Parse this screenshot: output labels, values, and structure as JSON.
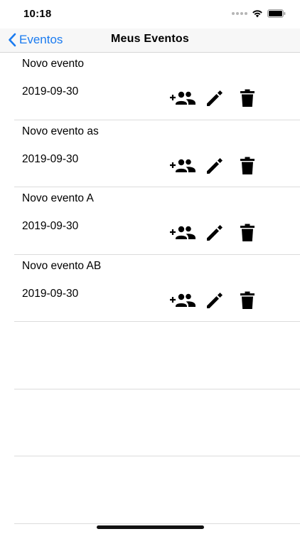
{
  "status_bar": {
    "time": "10:18"
  },
  "nav": {
    "back_label": "Eventos",
    "title": "Meus Eventos"
  },
  "events": [
    {
      "title": "Novo evento",
      "date": "2019-09-30"
    },
    {
      "title": "Novo evento as",
      "date": "2019-09-30"
    },
    {
      "title": "Novo evento A",
      "date": "2019-09-30"
    },
    {
      "title": "Novo evento AB",
      "date": "2019-09-30"
    }
  ],
  "icons": {
    "back": "chevron-left-icon",
    "add_people": "group-add-icon",
    "edit": "pencil-icon",
    "delete": "trash-icon"
  },
  "colors": {
    "accent": "#1a7bf0",
    "separator": "#dcdcdc"
  }
}
